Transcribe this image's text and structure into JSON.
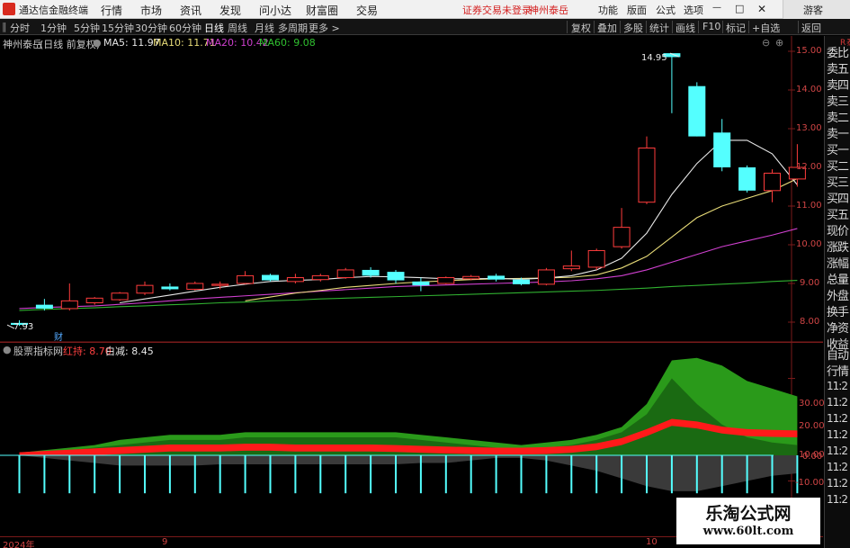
{
  "app": {
    "title": "通达信金融终端"
  },
  "menu": {
    "items": [
      "行情",
      "市场",
      "资讯",
      "发现",
      "问小达",
      "财富圈",
      "交易"
    ],
    "alert": "证券交易未登录",
    "stock": "神州泰岳",
    "right": [
      "功能",
      "版面",
      "公式",
      "选项"
    ],
    "guest": "游客"
  },
  "periods": [
    "分时",
    "1分钟",
    "5分钟",
    "15分钟",
    "30分钟",
    "60分钟",
    "日线",
    "周线",
    "月线",
    "多周期",
    "更多 >"
  ],
  "active_period": "日线",
  "tools": [
    "复权",
    "叠加",
    "多股",
    "统计",
    "画线",
    "F10",
    "标记",
    "+自选",
    "返回"
  ],
  "main": {
    "name": "神州泰岳",
    "mode": "(日线 前复权)",
    "ma5": "MA5: 11.97",
    "ma10": "MA10: 11.71",
    "ma20": "MA20: 10.42",
    "ma60": "MA60: 9.08",
    "high_label": "14.95",
    "low_label": "7.93",
    "cai_marker": "财",
    "y_ticks": [
      "15.00",
      "14.00",
      "13.00",
      "12.00",
      "11.00",
      "10.00",
      "9.00",
      "8.00"
    ]
  },
  "sub": {
    "name": "股票指标网",
    "red": "红持: 8.70",
    "white": "白减: 8.45",
    "y_ticks": [
      "30.00",
      "20.00",
      "10.00",
      "0.00",
      "-10.00"
    ]
  },
  "colors": {
    "up": "#ff3c3c",
    "down": "#54ffff",
    "ma5": "#e8e8e8",
    "ma10": "#e8dc78",
    "ma20": "#d040d0",
    "ma60": "#30b030"
  },
  "side": {
    "header": "R 泰",
    "labels": [
      "委比",
      "卖五",
      "卖四",
      "卖三",
      "卖二",
      "卖一",
      "买一",
      "买二",
      "买三",
      "买四",
      "买五",
      "现价",
      "涨跌",
      "涨幅",
      "总量",
      "外盘",
      "换手",
      "净资",
      "收益",
      "自动",
      "行情",
      "11:2",
      "11:2",
      "11:2",
      "11:2",
      "11:2",
      "11:2",
      "11:2",
      "11:2"
    ]
  },
  "xaxis": {
    "labels": [
      "2024年",
      "9",
      "10"
    ]
  },
  "watermark": {
    "title": "乐淘公式网",
    "url": "www.60lt.com"
  },
  "chart_data": {
    "type": "candlestick",
    "ylim": [
      7.6,
      15.4
    ],
    "candles": [
      [
        7.98,
        8.05,
        7.9,
        7.93
      ],
      [
        8.45,
        8.6,
        8.3,
        8.35
      ],
      [
        8.35,
        9.0,
        8.3,
        8.55
      ],
      [
        8.5,
        8.65,
        8.45,
        8.62
      ],
      [
        8.58,
        8.78,
        8.55,
        8.75
      ],
      [
        8.75,
        9.05,
        8.7,
        8.95
      ],
      [
        8.92,
        9.0,
        8.82,
        8.85
      ],
      [
        8.85,
        9.05,
        8.82,
        9.0
      ],
      [
        8.95,
        9.05,
        8.85,
        8.98
      ],
      [
        9.0,
        9.32,
        8.98,
        9.2
      ],
      [
        9.22,
        9.25,
        9.05,
        9.08
      ],
      [
        9.05,
        9.25,
        9.0,
        9.15
      ],
      [
        9.1,
        9.25,
        9.05,
        9.2
      ],
      [
        9.15,
        9.4,
        9.12,
        9.35
      ],
      [
        9.35,
        9.42,
        9.15,
        9.2
      ],
      [
        9.3,
        9.35,
        9.0,
        9.08
      ],
      [
        9.05,
        9.15,
        8.8,
        8.95
      ],
      [
        9.0,
        9.18,
        8.98,
        9.15
      ],
      [
        9.12,
        9.22,
        9.08,
        9.18
      ],
      [
        9.2,
        9.25,
        9.05,
        9.1
      ],
      [
        9.1,
        9.15,
        8.95,
        8.98
      ],
      [
        8.98,
        9.4,
        8.95,
        9.35
      ],
      [
        9.38,
        9.85,
        9.32,
        9.45
      ],
      [
        9.42,
        9.9,
        9.35,
        9.85
      ],
      [
        9.95,
        10.95,
        9.9,
        10.45
      ],
      [
        11.1,
        12.8,
        11.05,
        12.5
      ],
      [
        14.95,
        14.95,
        13.4,
        14.85
      ],
      [
        14.1,
        14.2,
        12.8,
        12.8
      ],
      [
        12.9,
        13.25,
        11.9,
        12.0
      ],
      [
        12.0,
        12.05,
        11.35,
        11.4
      ],
      [
        11.4,
        11.95,
        11.1,
        11.85
      ],
      [
        11.7,
        12.6,
        11.5,
        12.0
      ]
    ],
    "ma5": [
      null,
      null,
      null,
      null,
      8.5,
      8.6,
      8.7,
      8.8,
      8.9,
      8.98,
      9.05,
      9.08,
      9.1,
      9.15,
      9.18,
      9.17,
      9.15,
      9.12,
      9.12,
      9.13,
      9.11,
      9.14,
      9.2,
      9.35,
      9.65,
      10.3,
      11.3,
      12.1,
      12.7,
      12.7,
      12.35,
      11.55
    ],
    "ma10": [
      null,
      null,
      null,
      null,
      null,
      null,
      null,
      null,
      null,
      8.55,
      8.65,
      8.75,
      8.82,
      8.9,
      8.95,
      9.0,
      9.04,
      9.07,
      9.1,
      9.12,
      9.13,
      9.14,
      9.16,
      9.22,
      9.4,
      9.7,
      10.2,
      10.7,
      11.0,
      11.2,
      11.4,
      11.71
    ],
    "ma20": [
      8.35,
      8.38,
      8.4,
      8.42,
      8.46,
      8.5,
      8.55,
      8.6,
      8.64,
      8.68,
      8.72,
      8.76,
      8.8,
      8.84,
      8.88,
      8.92,
      8.94,
      8.96,
      8.98,
      9.0,
      9.02,
      9.04,
      9.07,
      9.12,
      9.2,
      9.35,
      9.55,
      9.75,
      9.95,
      10.1,
      10.25,
      10.42
    ],
    "ma60": [
      8.3,
      8.33,
      8.35,
      8.37,
      8.4,
      8.42,
      8.45,
      8.47,
      8.5,
      8.52,
      8.55,
      8.57,
      8.6,
      8.62,
      8.64,
      8.66,
      8.68,
      8.7,
      8.72,
      8.74,
      8.76,
      8.78,
      8.8,
      8.82,
      8.85,
      8.88,
      8.92,
      8.95,
      8.98,
      9.01,
      9.05,
      9.08
    ],
    "sub": {
      "ylim": [
        -17,
        42
      ],
      "green_upper": [
        1,
        2,
        3,
        4,
        6,
        7,
        8,
        8,
        8,
        9,
        9,
        9,
        9,
        9,
        9,
        9,
        8,
        7,
        6,
        5,
        4,
        5,
        6,
        8,
        11,
        20,
        37,
        38,
        35,
        29,
        26,
        23
      ],
      "green_mid": [
        0,
        1,
        2,
        3,
        4,
        5,
        6,
        6,
        6,
        7,
        7,
        7,
        7,
        7,
        7,
        7,
        6,
        5,
        4,
        3,
        3,
        3,
        4,
        6,
        9,
        16,
        30,
        20,
        12,
        7,
        5,
        4
      ],
      "red_line": [
        0,
        0.5,
        1,
        1.5,
        2,
        2.5,
        3,
        3,
        3,
        3.3,
        3.3,
        3,
        3,
        3,
        3,
        2.8,
        2.5,
        2.2,
        2,
        1.8,
        1.8,
        2,
        2.5,
        3.5,
        5.5,
        9,
        13,
        12,
        10,
        9,
        8.7,
        8.5
      ],
      "white_area": [
        0,
        -1,
        -2,
        -3,
        -4,
        -4,
        -4,
        -4,
        -3.5,
        -3.5,
        -3.5,
        -3.5,
        -3.5,
        -3.5,
        -3.5,
        -3.5,
        -3,
        -3,
        -2,
        -1,
        -1,
        -2,
        -4,
        -6,
        -9,
        -12,
        -14,
        -14,
        -12,
        -10,
        -8,
        -7
      ]
    }
  }
}
